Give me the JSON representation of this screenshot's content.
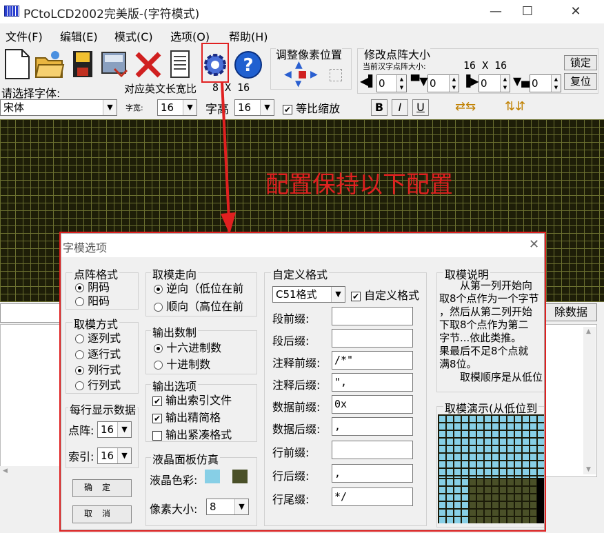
{
  "window": {
    "title": "PCtoLCD2002完美版-(字符模式)",
    "minimize": "—",
    "maximize": "☐",
    "close": "✕"
  },
  "menu": [
    "文件(F)",
    "编辑(E)",
    "模式(C)",
    "选项(O)",
    "帮助(H)"
  ],
  "toolbar": {
    "icons": [
      "new-file-icon",
      "open-folder-icon",
      "save-icon",
      "save-as-icon",
      "delete-icon",
      "notepad-icon",
      "settings-gear-icon",
      "help-icon"
    ],
    "highlight_color": "#e02020"
  },
  "pos_adjust": {
    "label": "调整像素位置"
  },
  "matrix_size": {
    "label": "修改点阵大小",
    "current_label": "当前汉字点阵大小:",
    "current": "16 X 16",
    "lock": "锁定",
    "reset": "复位",
    "spins": [
      "0",
      "0",
      "0",
      "0"
    ]
  },
  "font": {
    "label": "请选择字体:",
    "value": "宋体",
    "ascii_label": "对应英文长宽比",
    "ascii_ratio": "8 X 16",
    "width_label": "字宽:",
    "width": "16",
    "height_label": "字高",
    "height": "16",
    "scale_label": "等比缩放",
    "bold": "B",
    "italic": "I",
    "underline": "U"
  },
  "annotation": "配置保持以下配置",
  "bg": {
    "clear_btn": "除数据"
  },
  "dialog": {
    "title": "字模选项",
    "close": "✕",
    "dot_format": {
      "label": "点阵格式",
      "opts": [
        "阴码",
        "阳码"
      ]
    },
    "scan_dir": {
      "label": "取模走向",
      "opts": [
        "逆向（低位在前",
        "顺向（高位在前"
      ]
    },
    "custom_format": {
      "label": "自定义格式",
      "format": "C51格式",
      "custom_label": "自定义格式",
      "fields": [
        {
          "label": "段前缀:",
          "value": ""
        },
        {
          "label": "段后缀:",
          "value": ""
        },
        {
          "label": "注释前缀:",
          "value": "/*\""
        },
        {
          "label": "注释后缀:",
          "value": "\","
        },
        {
          "label": "数据前缀:",
          "value": "0x"
        },
        {
          "label": "数据后缀:",
          "value": ","
        },
        {
          "label": "行前缀:",
          "value": ""
        },
        {
          "label": "行后缀:",
          "value": ","
        },
        {
          "label": "行尾缀:",
          "value": "*/"
        }
      ]
    },
    "desc": {
      "label": "取模说明",
      "lines": [
        "　　从第一列开始向",
        "取8个点作为一个字节",
        "，然后从第二列开始",
        "下取8个点作为第二",
        "字节...依此类推。",
        "果最后不足8个点就",
        "满8位。",
        "　　取模顺序是从低位"
      ]
    },
    "scan_mode": {
      "label": "取模方式",
      "opts": [
        "逐列式",
        "逐行式",
        "列行式",
        "行列式"
      ]
    },
    "radix": {
      "label": "输出数制",
      "opts": [
        "十六进制数",
        "十进制数"
      ]
    },
    "out_opts": {
      "label": "输出选项",
      "opts": [
        "输出索引文件",
        "输出精简格",
        "输出紧凑格式"
      ]
    },
    "per_row": {
      "label": "每行显示数据",
      "dot_label": "点阵:",
      "dot": "16",
      "idx_label": "索引:",
      "idx": "16"
    },
    "lcd": {
      "label": "液晶面板仿真",
      "color_label": "液晶色彩:",
      "pix_label": "像素大小:",
      "pix": "8",
      "color_on": "#87cfe6",
      "color_off": "#4a5028"
    },
    "demo": {
      "label": "取模演示(从低位到"
    },
    "ok": "确定",
    "cancel": "取消"
  }
}
